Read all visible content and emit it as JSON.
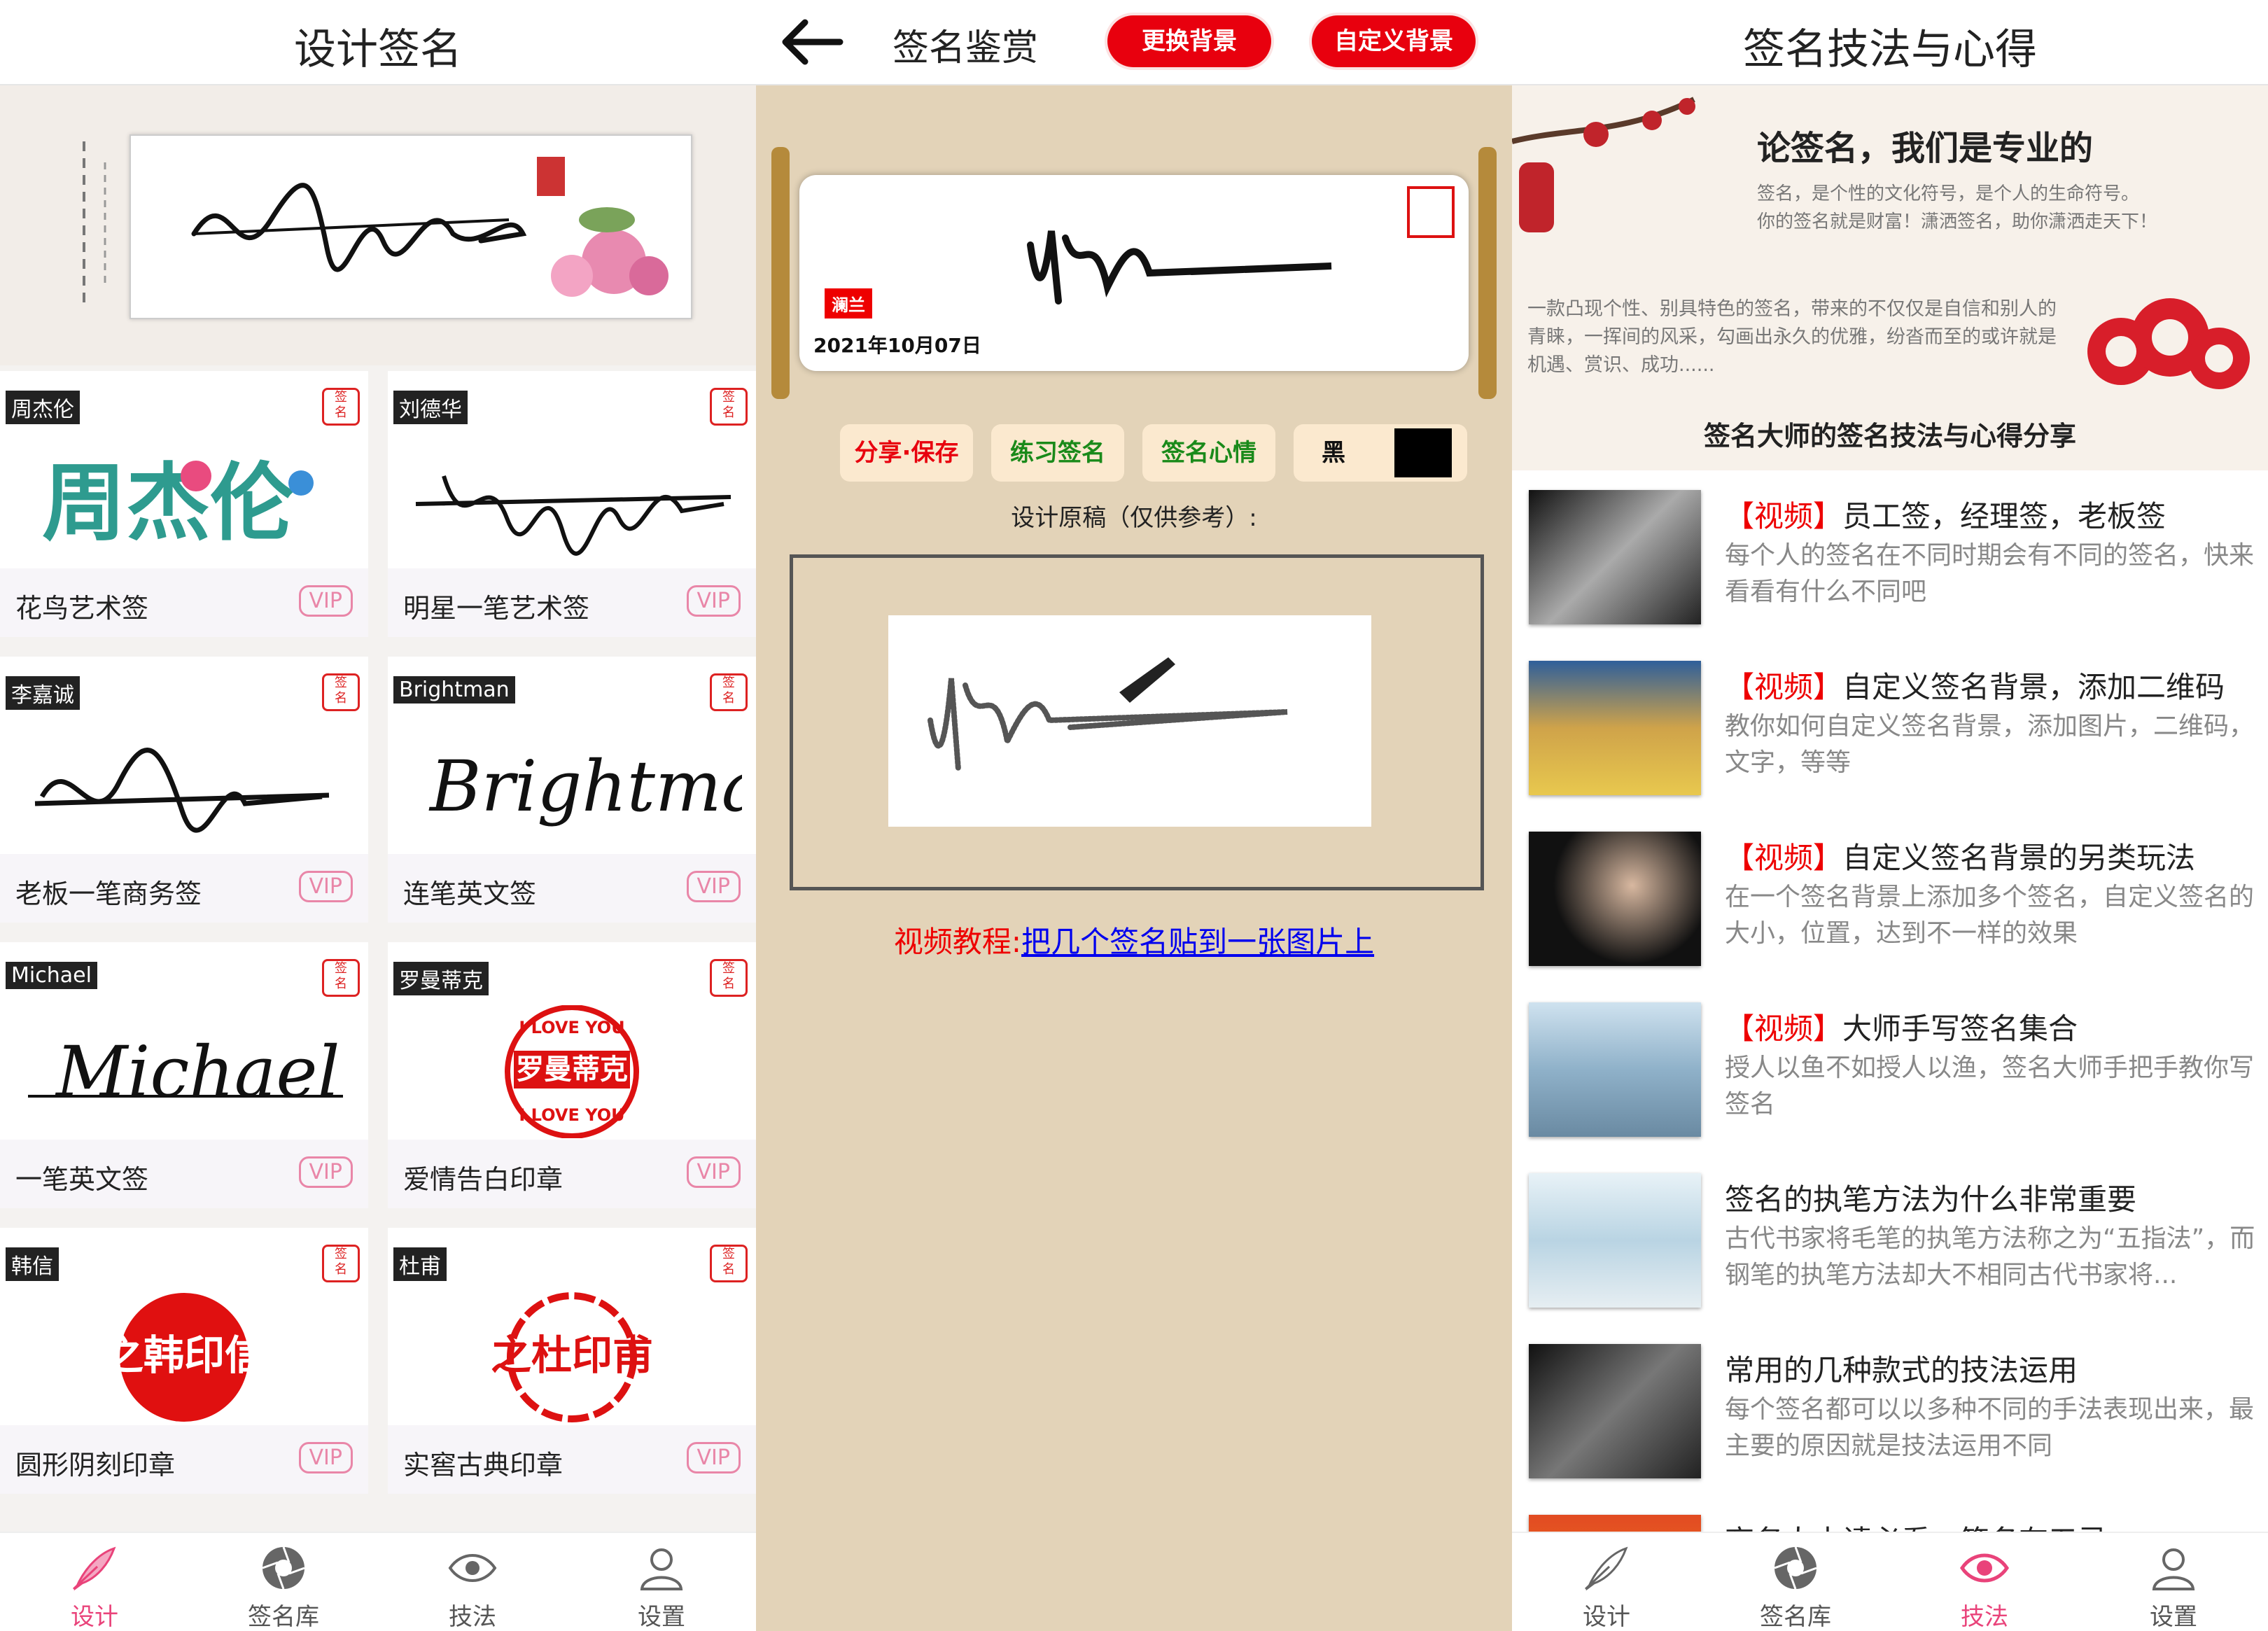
{
  "panel1": {
    "title": "设计签名",
    "cards": [
      {
        "tag": "周杰伦",
        "label": "花鸟艺术签",
        "vip": "VIP"
      },
      {
        "tag": "刘德华",
        "label": "明星一笔艺术签",
        "vip": "VIP"
      },
      {
        "tag": "李嘉诚",
        "label": "老板一笔商务签",
        "vip": "VIP"
      },
      {
        "tag": "Brightman",
        "label": "连笔英文签",
        "vip": "VIP"
      },
      {
        "tag": "Michael",
        "label": "一笔英文签",
        "vip": "VIP"
      },
      {
        "tag": "罗曼蒂克",
        "label": "爱情告白印章",
        "vip": "VIP"
      },
      {
        "tag": "韩信",
        "label": "圆形阴刻印章",
        "vip": "VIP"
      },
      {
        "tag": "杜甫",
        "label": "实窖古典印章",
        "vip": "VIP"
      }
    ],
    "card_art": {
      "c1": "周杰伦",
      "c4": "Brightman",
      "c5": "Michael",
      "c6_top": "I LOVE YOU",
      "c6_mid": "罗曼蒂克",
      "c6_bot": "I LOVE YOU",
      "c7": "之韩印信",
      "c8": "之杜印甫"
    }
  },
  "panel2": {
    "title": "签名鉴赏",
    "btn_change_bg": "更换背景",
    "btn_custom_bg": "自定义背景",
    "name_tag": "澜兰",
    "date": "2021年10月07日",
    "btn_share": "分享·保存",
    "btn_practice": "练习签名",
    "btn_mood": "签名心情",
    "btn_color": "黑",
    "draft_label": "设计原稿（仅供参考）:",
    "tutorial_prefix": "视频教程:",
    "tutorial_link": "把几个签名贴到一张图片上"
  },
  "panel3": {
    "title": "签名技法与心得",
    "hero_title": "论签名，我们是专业的",
    "hero_sub1": "签名，是个性的文化符号，是个人的生命符号。",
    "hero_sub2": "你的签名就是财富！潇洒签名，助你潇洒走天下！",
    "hero_body": "一款凸现个性、别具特色的签名，带来的不仅仅是自信和别人的青睐，一挥间的风采，勾画出永久的优雅，纷沓而至的或许就是机遇、赏识、成功......",
    "section_title": "签名大师的签名技法与心得分享",
    "items": [
      {
        "tag": "【视频】",
        "title": "员工签，经理签，老板签",
        "desc": "每个人的签名在不同时期会有不同的签名，快来看看有什么不同吧"
      },
      {
        "tag": "【视频】",
        "title": "自定义签名背景，添加二维码",
        "desc": "教你如何自定义签名背景，添加图片，二维码，文字，等等"
      },
      {
        "tag": "【视频】",
        "title": "自定义签名背景的另类玩法",
        "desc": "在一个签名背景上添加多个签名，自定义签名的大小，位置，达到不一样的效果"
      },
      {
        "tag": "【视频】",
        "title": "大师手写签名集合",
        "desc": "授人以鱼不如授人以渔，签名大师手把手教你写签名"
      },
      {
        "tag": "",
        "title": "签名的执笔方法为什么非常重要",
        "desc": "古代书家将毛笔的执笔方法称之为“五指法”，而钢笔的执笔方法却大不相同古代书家将..."
      },
      {
        "tag": "",
        "title": "常用的几种款式的技法运用",
        "desc": "每个签名都可以以多种不同的手法表现出来，最主要的原因就是技法运用不同"
      },
      {
        "tag": "",
        "title": "商务人士请必看，签名有五忌",
        "desc": ""
      }
    ]
  },
  "tabs": [
    {
      "label": "设计",
      "icon": "pen-feather-icon"
    },
    {
      "label": "签名库",
      "icon": "aperture-icon"
    },
    {
      "label": "技法",
      "icon": "eye-icon"
    },
    {
      "label": "设置",
      "icon": "user-icon"
    }
  ],
  "colors": {
    "accent": "#e9437a",
    "red_button": "#e8000e",
    "link": "#0000ee",
    "tag_red": "#e00000"
  }
}
